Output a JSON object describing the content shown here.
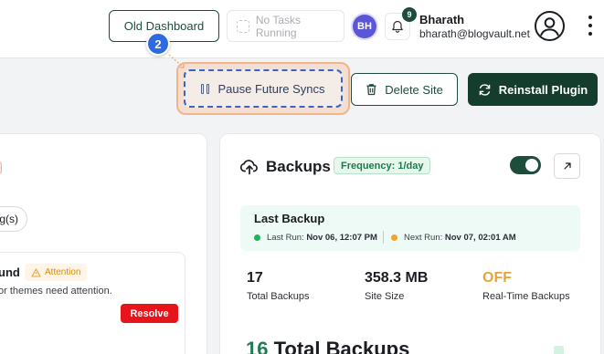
{
  "topbar": {
    "old_dashboard_label": "Old Dashboard",
    "tasks_label": "No Tasks Running",
    "avatar_initials": "BH",
    "notification_count": "9",
    "user_name": "Bharath",
    "user_email": "bharath@blogvault.net"
  },
  "tutorial": {
    "step_number": "2"
  },
  "actions": {
    "pause_label": "Pause Future Syncs",
    "delete_label": "Delete Site",
    "reinstall_label": "Reinstall Plugin"
  },
  "left_card": {
    "pill_label": "g(s)",
    "item_title": "und",
    "attention_label": "Attention",
    "description": "or themes need attention.",
    "resolve_label": "Resolve"
  },
  "backups": {
    "title": "Backups",
    "frequency": "Frequency: 1/day",
    "toggle_on": true,
    "last_backup": {
      "title": "Last Backup",
      "last_run_label": "Last Run:",
      "last_run_value": "Nov 06, 12:07 PM",
      "next_run_label": "Next Run:",
      "next_run_value": "Nov 07, 02:01 AM"
    },
    "stats": [
      {
        "value": "17",
        "label": "Total Backups"
      },
      {
        "value": "358.3 MB",
        "label": "Site Size"
      },
      {
        "value": "OFF",
        "label": "Real-Time Backups"
      }
    ],
    "total_count": "16",
    "total_label": "Total Backups"
  },
  "colors": {
    "brand_dark_green": "#143d2e",
    "accent_green": "#1f4d3b",
    "highlight_orange": "#f2b48c",
    "step_blue": "#2f6be0",
    "danger_red": "#e8141b",
    "warning_orange": "#e8a33a"
  }
}
